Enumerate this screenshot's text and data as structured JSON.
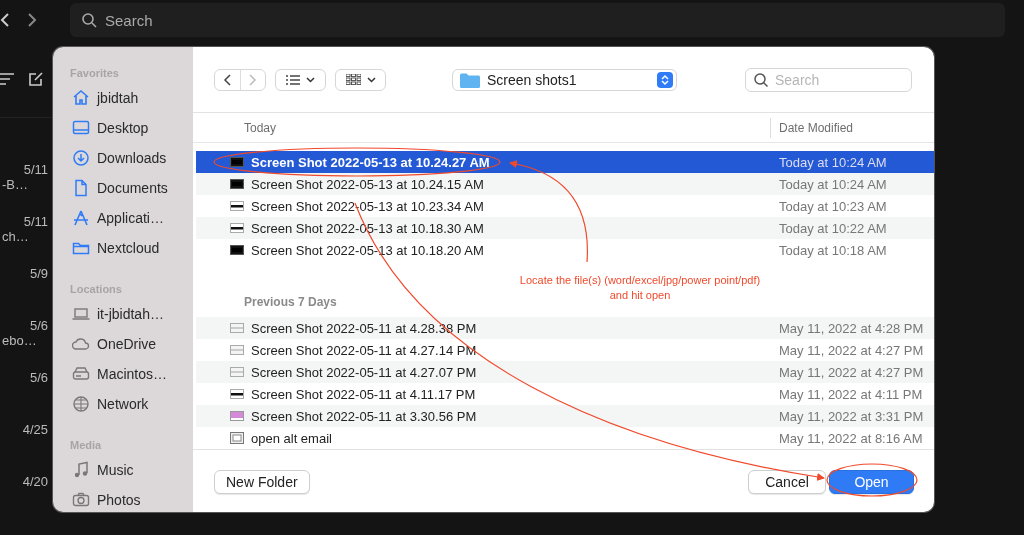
{
  "app": {
    "search": {
      "placeholder": "Search"
    },
    "messages": [
      {
        "date": "5/11",
        "snippet": "-B…"
      },
      {
        "date": "5/11",
        "snippet": "ch…"
      },
      {
        "date": "5/9"
      },
      {
        "date": "5/6",
        "snippet": "ebo…"
      },
      {
        "date": "5/6"
      },
      {
        "date": "4/25"
      },
      {
        "date": "4/20"
      }
    ]
  },
  "dialog": {
    "sidebar": [
      {
        "title": "Favorites",
        "items": [
          {
            "label": "jbidtah",
            "kind": "home"
          },
          {
            "label": "Desktop",
            "kind": "desktop"
          },
          {
            "label": "Downloads",
            "kind": "download"
          },
          {
            "label": "Documents",
            "kind": "document"
          },
          {
            "label": "Applicati…",
            "kind": "apps"
          },
          {
            "label": "Nextcloud",
            "kind": "folder"
          }
        ]
      },
      {
        "title": "Locations",
        "items": [
          {
            "label": "it-jbidtah…",
            "kind": "laptop"
          },
          {
            "label": "OneDrive",
            "kind": "cloud"
          },
          {
            "label": "Macintos…",
            "kind": "disk"
          },
          {
            "label": "Network",
            "kind": "globe"
          }
        ]
      },
      {
        "title": "Media",
        "items": [
          {
            "label": "Music",
            "kind": "music"
          },
          {
            "label": "Photos",
            "kind": "camera"
          }
        ]
      }
    ],
    "folder": "Screen shots1",
    "search": {
      "placeholder": "Search"
    },
    "date_column": "Date Modified",
    "groups": [
      {
        "title": "Today",
        "rows": [
          {
            "name": "Screen Shot 2022-05-13 at 10.24.27 AM",
            "date": "Today at 10:24 AM",
            "kind": "dark",
            "selected": true
          },
          {
            "name": "Screen Shot 2022-05-13 at 10.24.15 AM",
            "date": "Today at 10:24 AM",
            "kind": "dark",
            "selected": false
          },
          {
            "name": "Screen Shot 2022-05-13 at 10.23.34 AM",
            "date": "Today at 10:23 AM",
            "kind": "striped",
            "selected": false
          },
          {
            "name": "Screen Shot 2022-05-13 at 10.18.30 AM",
            "date": "Today at 10:22 AM",
            "kind": "striped",
            "selected": false
          },
          {
            "name": "Screen Shot 2022-05-13 at 10.18.20 AM",
            "date": "Today at 10:18 AM",
            "kind": "dark",
            "selected": false
          }
        ]
      },
      {
        "title": "Previous 7 Days",
        "rows": [
          {
            "name": "Screen Shot 2022-05-11 at 4.28.38 PM",
            "date": "May 11, 2022 at 4:28 PM",
            "kind": "light",
            "selected": false
          },
          {
            "name": "Screen Shot 2022-05-11 at 4.27.14 PM",
            "date": "May 11, 2022 at 4:27 PM",
            "kind": "light",
            "selected": false
          },
          {
            "name": "Screen Shot 2022-05-11 at 4.27.07 PM",
            "date": "May 11, 2022 at 4:27 PM",
            "kind": "light",
            "selected": false
          },
          {
            "name": "Screen Shot 2022-05-11 at 4.11.17 PM",
            "date": "May 11, 2022 at 4:11 PM",
            "kind": "striped",
            "selected": false
          },
          {
            "name": "Screen Shot 2022-05-11 at 3.30.56 PM",
            "date": "May 11, 2022 at 3:31 PM",
            "kind": "pink",
            "selected": false
          },
          {
            "name": "open alt email",
            "date": "May 11, 2022 at 8:16 AM",
            "kind": "window",
            "selected": false
          }
        ]
      }
    ],
    "buttons": [
      {
        "label": "New Folder",
        "kind": "plain"
      },
      {
        "label": "Cancel",
        "kind": "plain"
      },
      {
        "label": "Open",
        "kind": "default"
      }
    ]
  },
  "annotation": {
    "note": "Locate the file(s) (word/excel/jpg/power point/pdf)\nand hit open"
  }
}
